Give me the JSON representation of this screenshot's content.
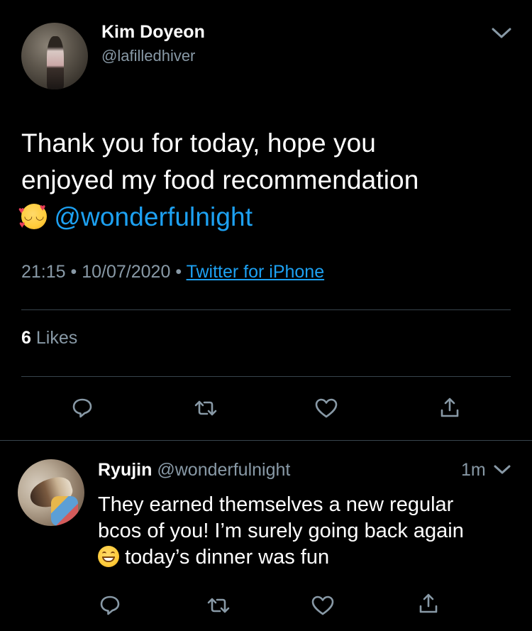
{
  "tweet": {
    "author_name": "Kim Doyeon",
    "author_handle": "@lafilledhiver",
    "text_line1": "Thank you for today, hope you",
    "text_line2": "enjoyed my food recommendation",
    "emoji": "smiling-face-with-hearts",
    "mention": "@wonderfulnight",
    "time": "21:15",
    "date": "10/07/2020",
    "separator": "•",
    "source": "Twitter for iPhone",
    "likes_count": "6",
    "likes_label": "Likes"
  },
  "reply": {
    "author_name": "Ryujin",
    "author_handle": "@wonderfulnight",
    "time": "1m",
    "text_line1": "They earned themselves a new regular",
    "text_line2": "bcos of you! I’m surely going back again",
    "emoji": "grinning-face-with-smiling-eyes",
    "text_line3": "today’s dinner was fun"
  },
  "colors": {
    "background": "#000000",
    "text": "#ffffff",
    "secondary": "#8899a6",
    "link": "#1da1f2",
    "divider": "#38444d"
  },
  "icons": {
    "reply": "reply-icon",
    "retweet": "retweet-icon",
    "like": "heart-icon",
    "share": "share-icon",
    "more": "chevron-down-icon"
  }
}
